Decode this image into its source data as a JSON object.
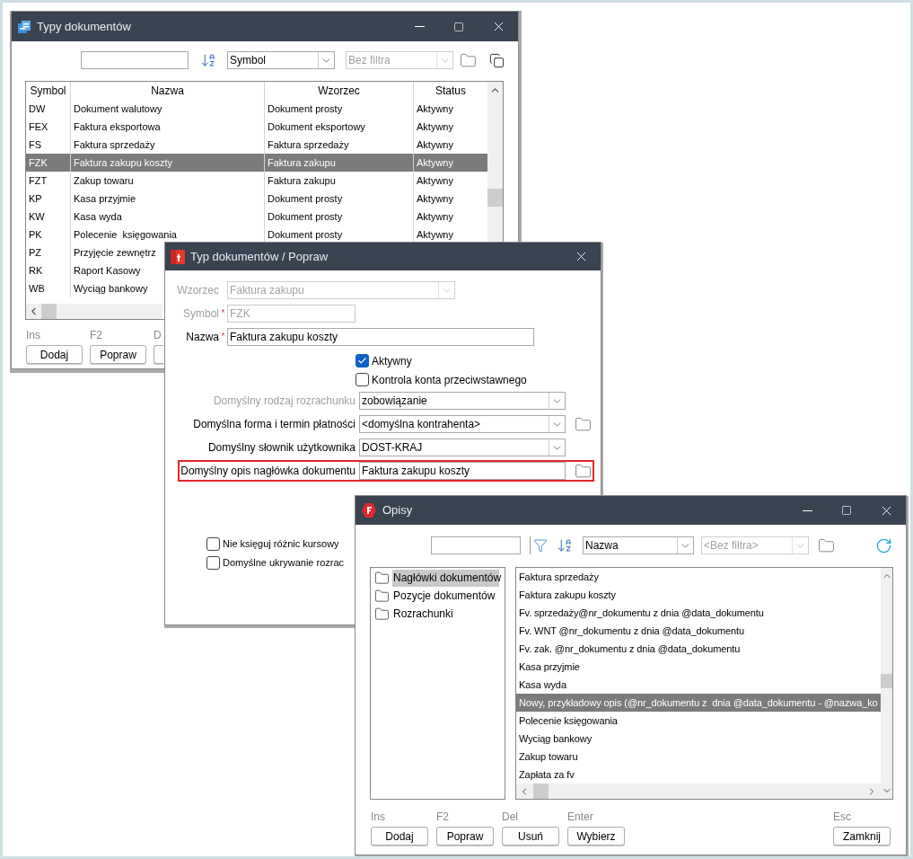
{
  "types_window": {
    "title": "Typy dokumentów",
    "sort_combo": {
      "value": "Symbol",
      "disabled": false
    },
    "filter_combo": {
      "value": "Bez filtra",
      "disabled": true
    },
    "table": {
      "columns": [
        "Symbol",
        "Nazwa",
        "Wzorzec",
        "Status"
      ],
      "rows": [
        {
          "cells": [
            "DW",
            "Dokument walutowy",
            "Dokument prosty",
            "Aktywny"
          ],
          "selected": false
        },
        {
          "cells": [
            "FEX",
            "Faktura eksportowa",
            "Dokument eksportowy",
            "Aktywny"
          ],
          "selected": false
        },
        {
          "cells": [
            "FS",
            "Faktura sprzedaży",
            "Faktura sprzedaży",
            "Aktywny"
          ],
          "selected": false
        },
        {
          "cells": [
            "FZK",
            "Faktura zakupu koszty",
            "Faktura zakupu",
            "Aktywny"
          ],
          "selected": true
        },
        {
          "cells": [
            "FZT",
            "Zakup towaru",
            "Faktura zakupu",
            "Aktywny"
          ],
          "selected": false
        },
        {
          "cells": [
            "KP",
            "Kasa przyjmie",
            "Dokument prosty",
            "Aktywny"
          ],
          "selected": false
        },
        {
          "cells": [
            "KW",
            "Kasa wyda",
            "Dokument prosty",
            "Aktywny"
          ],
          "selected": false
        },
        {
          "cells": [
            "PK",
            "Polecenie  księgowania",
            "Dokument prosty",
            "Aktywny"
          ],
          "selected": false
        },
        {
          "cells": [
            "PZ",
            "Przyjęcie zewnętrz"
          ],
          "selected": false
        },
        {
          "cells": [
            "RK",
            "Raport Kasowy"
          ],
          "selected": false
        },
        {
          "cells": [
            "WB",
            "Wyciąg bankowy"
          ],
          "selected": false
        }
      ]
    },
    "buttons": [
      {
        "hint": "Ins",
        "label": "Dodaj"
      },
      {
        "hint": "F2",
        "label": "Popraw"
      },
      {
        "hint": "D"
      }
    ]
  },
  "edit_window": {
    "title": "Typ dokumentów / Popraw",
    "fields": [
      {
        "kind": "combo",
        "label": "Wzorzec",
        "value": "Faktura zakupu",
        "disabled": true
      },
      {
        "kind": "short",
        "label": "Symbol",
        "required_mark": "*",
        "value": "FZK",
        "disabled": true
      },
      {
        "kind": "long",
        "label": "Nazwa",
        "required_mark": "*",
        "value": "Faktura zakupu koszty",
        "disabled": false
      }
    ],
    "checkboxes": [
      {
        "label": "Aktywny",
        "checked": true
      },
      {
        "label": "Kontrola konta przeciwstawnego",
        "checked": false
      }
    ],
    "settings": [
      {
        "kind": "combo",
        "label": "Domyślny rodzaj rozrachunku",
        "value": "zobowiązanie",
        "label_disabled": true,
        "folder": false,
        "highlighted": false
      },
      {
        "kind": "combo",
        "label": "Domyślna forma i termin płatności",
        "value": "<domyślna kontrahenta>",
        "label_disabled": false,
        "folder": true,
        "highlighted": false
      },
      {
        "kind": "combo",
        "label": "Domyślny słownik użytkownika",
        "value": "DOST-KRAJ",
        "label_disabled": false,
        "folder": false,
        "highlighted": false
      },
      {
        "kind": "text",
        "label": "Domyślny opis nagłówka dokumentu",
        "value": "Faktura zakupu koszty",
        "label_disabled": false,
        "folder": true,
        "highlighted": true
      }
    ],
    "lower_checkboxes": [
      {
        "label": "Nie księguj różnic kursowy",
        "checked": false
      },
      {
        "label": "Domyślne ukrywanie rozrac",
        "checked": false
      }
    ]
  },
  "descriptions_window": {
    "title": "Opisy",
    "sort_combo": {
      "value": "Nazwa",
      "disabled": false
    },
    "filter_combo": {
      "value": "<Bez filtra>",
      "disabled": true
    },
    "tree": [
      {
        "label": "Nagłówki dokumentów",
        "selected": true
      },
      {
        "label": "Pozycje dokumentów",
        "selected": false
      },
      {
        "label": "Rozrachunki",
        "selected": false
      }
    ],
    "list": [
      {
        "label": "Faktura sprzedaży",
        "selected": false
      },
      {
        "label": "Faktura zakupu koszty",
        "selected": false
      },
      {
        "label": "Fv. sprzedaży@nr_dokumentu z dnia @data_dokumentu",
        "selected": false
      },
      {
        "label": "Fv. WNT @nr_dokumentu z dnia @data_dokumentu",
        "selected": false
      },
      {
        "label": "Fv. zak. @nr_dokumentu z dnia @data_dokumentu",
        "selected": false
      },
      {
        "label": "Kasa przyjmie",
        "selected": false
      },
      {
        "label": "Kasa wyda",
        "selected": false
      },
      {
        "label": "Nowy, przykładowy opis (@nr_dokumentu z  dnia @data_dokumentu - @nazwa_ko",
        "selected": true
      },
      {
        "label": "Polecenie księgowania",
        "selected": false
      },
      {
        "label": "Wyciąg bankowy",
        "selected": false
      },
      {
        "label": "Zakup towaru",
        "selected": false
      },
      {
        "label": "Zapłata za fv",
        "selected": false
      }
    ],
    "buttons": [
      {
        "hint": "Ins",
        "label": "Dodaj"
      },
      {
        "hint": "F2",
        "label": "Popraw"
      },
      {
        "hint": "Del",
        "label": "Usuń"
      },
      {
        "hint": "Enter",
        "label": "Wybierz"
      }
    ],
    "close_button": {
      "hint": "Esc",
      "label": "Zamknij"
    }
  }
}
